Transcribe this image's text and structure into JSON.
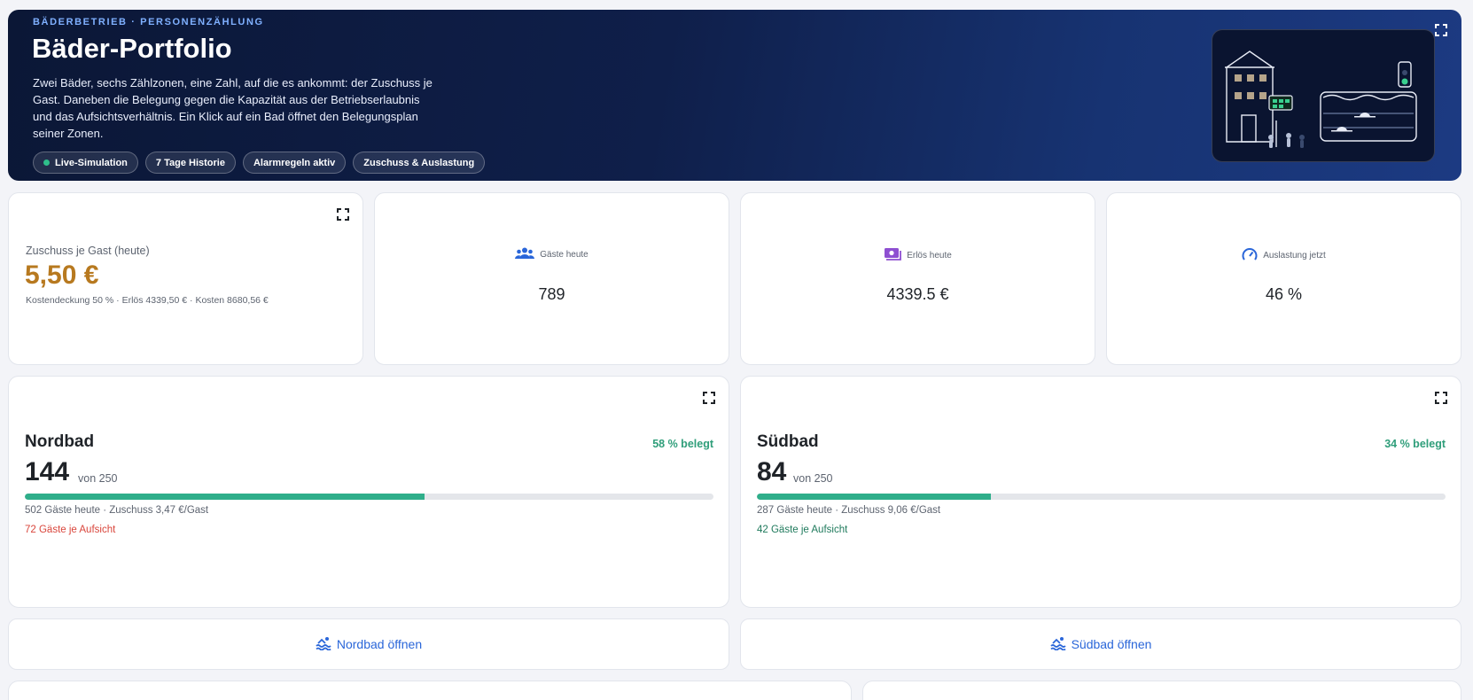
{
  "hero": {
    "kicker": "BÄDERBETRIEB · PERSONENZÄHLUNG",
    "title": "Bäder-Portfolio",
    "description": "Zwei Bäder, sechs Zählzonen, eine Zahl, auf die es ankommt: der Zuschuss je Gast. Daneben die Belegung gegen die Kapazität aus der Betriebserlaubnis und das Aufsichtsverhältnis. Ein Klick auf ein Bad öffnet den Belegungsplan seiner Zonen.",
    "chips": [
      "Live-Simulation",
      "7 Tage Historie",
      "Alarmregeln aktiv",
      "Zuschuss & Auslastung"
    ],
    "live_color": "#2fbf8a"
  },
  "kpis": {
    "subsidy": {
      "label": "Zuschuss je Gast (heute)",
      "value": "5,50 €",
      "detail": "Kostendeckung 50 % · Erlös 4339,50 € · Kosten 8680,56 €",
      "color": "#b7791f"
    },
    "guests": {
      "label": "Gäste heute",
      "value": "789",
      "icon": "users-icon",
      "color": "#2a66d9"
    },
    "revenue": {
      "label": "Erlös heute",
      "value": "4339.5 €",
      "icon": "cash-icon",
      "color": "#8e4fd1"
    },
    "utilization": {
      "label": "Auslastung jetzt",
      "value": "46 %",
      "icon": "gauge-icon",
      "color": "#2a66d9"
    }
  },
  "baths": [
    {
      "name": "Nordbad",
      "occupancy_label": "58 % belegt",
      "occupancy_fraction": 0.58,
      "count": "144",
      "capacity": "von 250",
      "summary": "502 Gäste heute · Zuschuss 3,47 €/Gast",
      "supervision": "72 Gäste je Aufsicht",
      "supervision_color": "#d9453b",
      "open_label": "Nordbad öffnen"
    },
    {
      "name": "Südbad",
      "occupancy_label": "34 % belegt",
      "occupancy_fraction": 0.34,
      "count": "84",
      "capacity": "von 250",
      "summary": "287 Gäste heute · Zuschuss 9,06 €/Gast",
      "supervision": "42 Gäste je Aufsicht",
      "supervision_color": "#1f7a5c",
      "open_label": "Südbad öffnen"
    }
  ],
  "colors": {
    "accent": "#2a66d9",
    "success": "#2f9e7a",
    "bar_fill": "#2fae8a"
  }
}
